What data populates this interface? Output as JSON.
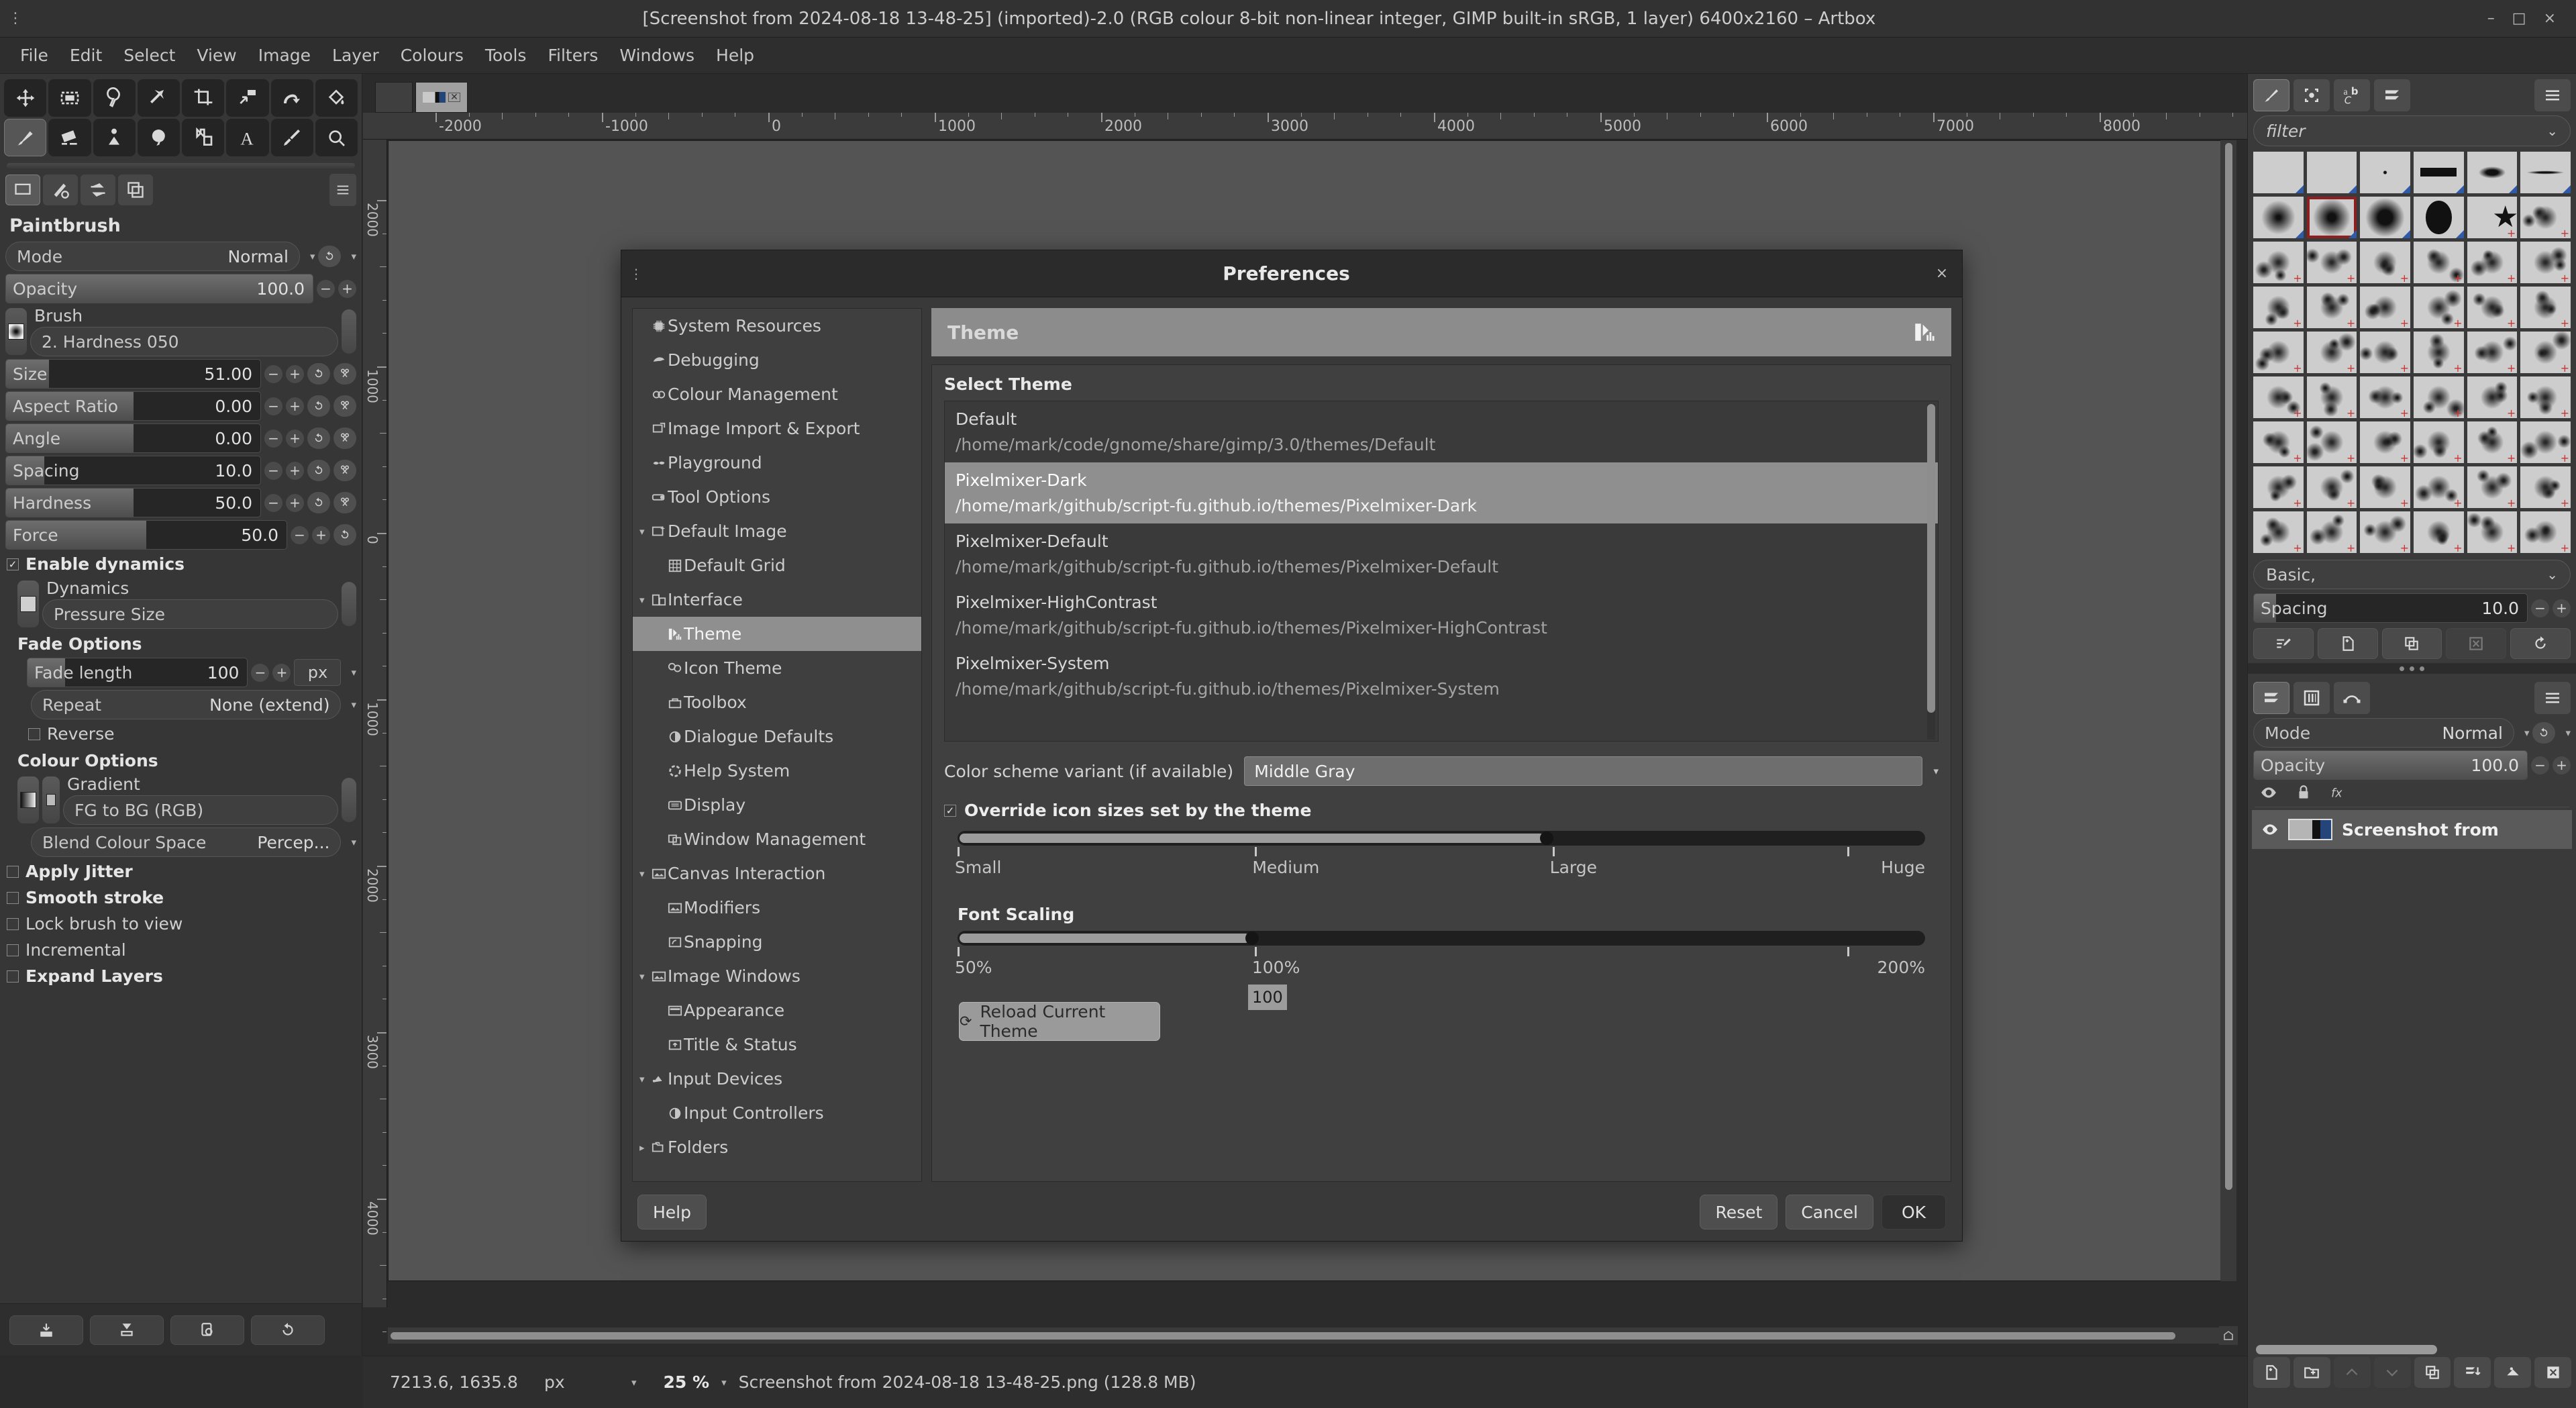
{
  "titlebar": {
    "title": "[Screenshot from 2024-08-18 13-48-25] (imported)-2.0 (RGB colour 8-bit non-linear integer, GIMP built-in sRGB, 1 layer) 6400x2160 – Artbox",
    "minimize": "–",
    "maximize": "□",
    "close": "×",
    "menu_icon": "⋮"
  },
  "menubar": {
    "items": [
      "File",
      "Edit",
      "Select",
      "View",
      "Image",
      "Layer",
      "Colours",
      "Tools",
      "Filters",
      "Windows",
      "Help"
    ]
  },
  "toolbox": {
    "tools_row1": [
      "move-tool",
      "rect-select-tool",
      "free-select-tool",
      "fuzzy-select-tool",
      "crop-tool",
      "transform-tool",
      "warp-tool",
      "bucket-fill-tool"
    ],
    "tools_row2": [
      "paintbrush-tool",
      "eraser-tool",
      "clone-tool",
      "smudge-tool",
      "ink-tool",
      "text-tool",
      "color-picker-tool",
      "zoom-tool"
    ],
    "selected_tool": "paintbrush-tool",
    "option_tabs": [
      "tool-options-tab",
      "device-status-tab",
      "undo-history-tab",
      "images-tab"
    ],
    "panel_title": "Paintbrush",
    "mode": {
      "label": "Mode",
      "value": "Normal"
    },
    "opacity": {
      "label": "Opacity",
      "value": "100.0"
    },
    "brush": {
      "label": "Brush",
      "value": "2. Hardness 050"
    },
    "sliders": [
      {
        "label": "Size",
        "value": "51.00",
        "fill_pct": 17
      },
      {
        "label": "Aspect Ratio",
        "value": "0.00",
        "fill_pct": 50
      },
      {
        "label": "Angle",
        "value": "0.00",
        "fill_pct": 50
      },
      {
        "label": "Spacing",
        "value": "10.0",
        "fill_pct": 15
      },
      {
        "label": "Hardness",
        "value": "50.0",
        "fill_pct": 50
      },
      {
        "label": "Force",
        "value": "50.0",
        "fill_pct": 50
      }
    ],
    "enable_dynamics": {
      "label": "Enable dynamics",
      "checked": true
    },
    "dynamics": {
      "label": "Dynamics",
      "value": "Pressure Size"
    },
    "fade_options": {
      "header": "Fade Options",
      "fade_length": {
        "label": "Fade length",
        "value": "100",
        "unit": "px"
      },
      "repeat": {
        "label": "Repeat",
        "value": "None (extend)"
      },
      "reverse": {
        "label": "Reverse",
        "checked": false
      }
    },
    "colour_options": {
      "header": "Colour Options",
      "gradient": {
        "label": "Gradient",
        "value": "FG to BG (RGB)"
      },
      "blend_colour_space": {
        "label": "Blend Colour Space",
        "value": "Percep..."
      }
    },
    "checkboxes": [
      {
        "label": "Apply Jitter",
        "checked": false,
        "bold": true
      },
      {
        "label": "Smooth stroke",
        "checked": false,
        "bold": true
      },
      {
        "label": "Lock brush to view",
        "checked": false,
        "bold": false
      },
      {
        "label": "Incremental",
        "checked": false,
        "bold": false
      },
      {
        "label": "Expand Layers",
        "checked": false,
        "bold": true
      }
    ],
    "bottom_buttons": [
      "save-tool-preset-icon",
      "restore-tool-preset-icon",
      "delete-tool-preset-icon",
      "reset-tool-options-icon"
    ]
  },
  "canvas": {
    "tabs": [
      "image-tab-1",
      "image-tab-2-active"
    ],
    "ruler_h_labels": [
      "-2000",
      "-1000",
      "0",
      "1000",
      "2000",
      "3000",
      "4000",
      "5000",
      "6000",
      "7000",
      "8000"
    ],
    "ruler_v_labels": [
      "2000",
      "1000",
      "0",
      "1000",
      "2000",
      "3000",
      "4000"
    ]
  },
  "statusbar": {
    "coords": "7213.6, 1635.8",
    "unit": "px",
    "zoom": "25 %",
    "filename": "Screenshot from 2024-08-18 13-48-25.png (128.8 MB)"
  },
  "right_dock": {
    "tabs": [
      "brushes-tab",
      "patterns-tab",
      "fonts-tab",
      "layers-tab"
    ],
    "selected_tab": "brushes-tab",
    "filter_placeholder": "filter",
    "brush_grid_rows": 9,
    "brush_grid_cols": 6,
    "selected_brush_index": 7,
    "basic_combo": "Basic,",
    "spacing": {
      "label": "Spacing",
      "value": "10.0"
    },
    "brush_buttons": [
      "edit-brush-icon",
      "new-brush-icon",
      "duplicate-brush-icon",
      "delete-brush-icon",
      "refresh-brushes-icon"
    ],
    "layers_tabs": [
      "layers-tab",
      "channels-tab",
      "paths-tab"
    ],
    "mode": {
      "label": "Mode",
      "value": "Normal"
    },
    "opacity": {
      "label": "Opacity",
      "value": "100.0"
    },
    "lock_icons": [
      "eye-icon",
      "lock-icon",
      "fx-icon"
    ],
    "layer": {
      "name": "Screenshot from",
      "visible": true
    },
    "footer_buttons": [
      "new-layer-icon",
      "new-group-icon",
      "raise-layer-icon",
      "lower-layer-icon",
      "duplicate-layer-icon",
      "merge-down-icon",
      "anchor-layer-icon",
      "delete-layer-icon"
    ]
  },
  "preferences": {
    "window_title": "Preferences",
    "menu_icon": "⋮",
    "close_icon": "×",
    "tree": [
      {
        "label": "System Resources",
        "level": 1,
        "icon": "chip-icon",
        "arrow": "",
        "selected": false
      },
      {
        "label": "Debugging",
        "level": 1,
        "icon": "bug-icon",
        "arrow": "",
        "selected": false
      },
      {
        "label": "Colour Management",
        "level": 1,
        "icon": "colour-icon",
        "arrow": "",
        "selected": false
      },
      {
        "label": "Image Import & Export",
        "level": 1,
        "icon": "import-export-icon",
        "arrow": "",
        "selected": false
      },
      {
        "label": "Playground",
        "level": 1,
        "icon": "playground-icon",
        "arrow": "",
        "selected": false
      },
      {
        "label": "Tool Options",
        "level": 1,
        "icon": "tool-options-icon",
        "arrow": "",
        "selected": false
      },
      {
        "label": "Default Image",
        "level": 1,
        "icon": "default-image-icon",
        "arrow": "▾",
        "selected": false
      },
      {
        "label": "Default Grid",
        "level": 2,
        "icon": "grid-icon",
        "arrow": "",
        "selected": false
      },
      {
        "label": "Interface",
        "level": 1,
        "icon": "interface-icon",
        "arrow": "▾",
        "selected": false
      },
      {
        "label": "Theme",
        "level": 2,
        "icon": "theme-icon",
        "arrow": "",
        "selected": true
      },
      {
        "label": "Icon Theme",
        "level": 2,
        "icon": "icon-theme-icon",
        "arrow": "",
        "selected": false
      },
      {
        "label": "Toolbox",
        "level": 2,
        "icon": "toolbox-icon",
        "arrow": "",
        "selected": false
      },
      {
        "label": "Dialogue Defaults",
        "level": 2,
        "icon": "dialog-icon",
        "arrow": "",
        "selected": false
      },
      {
        "label": "Help System",
        "level": 2,
        "icon": "help-icon",
        "arrow": "",
        "selected": false
      },
      {
        "label": "Display",
        "level": 2,
        "icon": "display-icon",
        "arrow": "",
        "selected": false
      },
      {
        "label": "Window Management",
        "level": 2,
        "icon": "window-icon",
        "arrow": "",
        "selected": false
      },
      {
        "label": "Canvas Interaction",
        "level": 1,
        "icon": "canvas-icon",
        "arrow": "▾",
        "selected": false
      },
      {
        "label": "Modifiers",
        "level": 2,
        "icon": "modifiers-icon",
        "arrow": "",
        "selected": false
      },
      {
        "label": "Snapping",
        "level": 2,
        "icon": "snapping-icon",
        "arrow": "",
        "selected": false
      },
      {
        "label": "Image Windows",
        "level": 1,
        "icon": "image-windows-icon",
        "arrow": "▾",
        "selected": false
      },
      {
        "label": "Appearance",
        "level": 2,
        "icon": "appearance-icon",
        "arrow": "",
        "selected": false
      },
      {
        "label": "Title & Status",
        "level": 2,
        "icon": "title-status-icon",
        "arrow": "",
        "selected": false
      },
      {
        "label": "Input Devices",
        "level": 1,
        "icon": "input-devices-icon",
        "arrow": "▾",
        "selected": false
      },
      {
        "label": "Input Controllers",
        "level": 2,
        "icon": "input-controllers-icon",
        "arrow": "",
        "selected": false
      },
      {
        "label": "Folders",
        "level": 1,
        "icon": "folders-icon",
        "arrow": "▸",
        "selected": false
      }
    ],
    "pane_title": "Theme",
    "pane_icon": "theme-icon",
    "select_theme_label": "Select Theme",
    "themes": [
      {
        "name": "Default",
        "path": "/home/mark/code/gnome/share/gimp/3.0/themes/Default",
        "selected": false
      },
      {
        "name": "Pixelmixer-Dark",
        "path": "/home/mark/github/script-fu.github.io/themes/Pixelmixer-Dark",
        "selected": true
      },
      {
        "name": "Pixelmixer-Default",
        "path": "/home/mark/github/script-fu.github.io/themes/Pixelmixer-Default",
        "selected": false
      },
      {
        "name": "Pixelmixer-HighContrast",
        "path": "/home/mark/github/script-fu.github.io/themes/Pixelmixer-HighContrast",
        "selected": false
      },
      {
        "name": "Pixelmixer-System",
        "path": "/home/mark/github/script-fu.github.io/themes/Pixelmixer-System",
        "selected": false
      }
    ],
    "colour_scheme_variant": {
      "label": "Color scheme variant (if available)",
      "value": "Middle Gray"
    },
    "override_icon_sizes": {
      "label": "Override icon sizes set by the theme",
      "checked": true
    },
    "icon_size_slider": {
      "labels": [
        "Small",
        "Medium",
        "Large",
        "Huge"
      ],
      "value_pct": 66
    },
    "font_scaling": {
      "header": "Font Scaling",
      "labels": [
        "50%",
        "100%",
        "200%"
      ],
      "value_pct": 33,
      "entry_value": "100"
    },
    "reload_button": {
      "label": "Reload Current Theme",
      "icon": "refresh-icon"
    },
    "footer": {
      "help": "Help",
      "reset": "Reset",
      "cancel": "Cancel",
      "ok": "OK"
    }
  }
}
